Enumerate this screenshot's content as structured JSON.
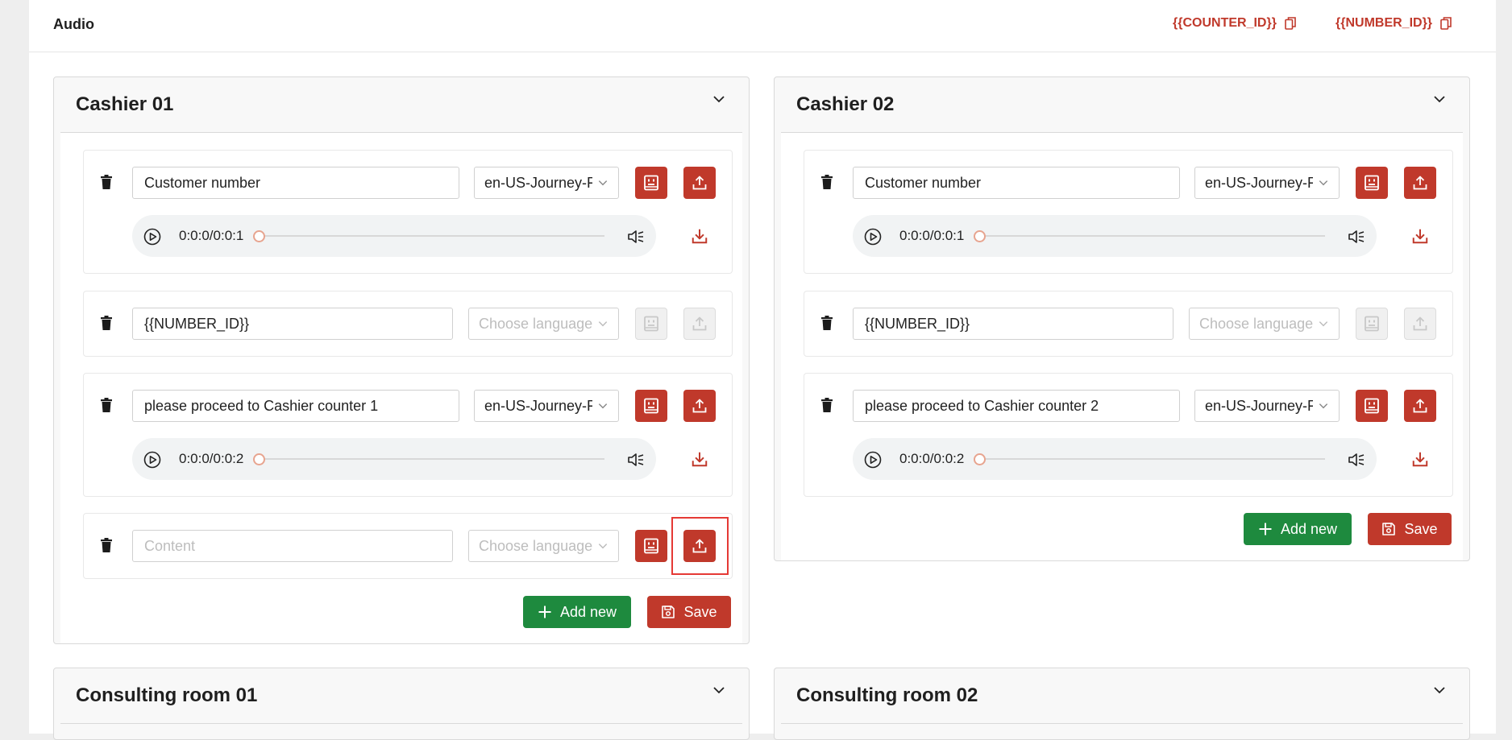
{
  "header": {
    "title": "Audio",
    "tags": [
      {
        "label": "{{COUNTER_ID}}",
        "icon": "copy-icon"
      },
      {
        "label": "{{NUMBER_ID}}",
        "icon": "copy-icon"
      }
    ]
  },
  "colors": {
    "accent": "#c0392b",
    "add_button": "#1e8a3e",
    "highlight": "#e53935"
  },
  "panels": [
    {
      "title": "Cashier 01",
      "items": [
        {
          "text": "Customer number",
          "language": "en-US-Journey-F",
          "time": "0:0:0/0:0:1"
        },
        {
          "text": "{{NUMBER_ID}}",
          "language_placeholder": "Choose language"
        },
        {
          "text": "please proceed to Cashier counter 1",
          "language": "en-US-Journey-F",
          "time": "0:0:0/0:0:2"
        },
        {
          "text_placeholder": "Content",
          "language_placeholder": "Choose language"
        }
      ],
      "add_label": "Add new",
      "save_label": "Save"
    },
    {
      "title": "Cashier 02",
      "items": [
        {
          "text": "Customer number",
          "language": "en-US-Journey-F",
          "time": "0:0:0/0:0:1"
        },
        {
          "text": "{{NUMBER_ID}}",
          "language_placeholder": "Choose language"
        },
        {
          "text": "please proceed to Cashier counter 2",
          "language": "en-US-Journey-F",
          "time": "0:0:0/0:0:2"
        }
      ],
      "add_label": "Add new",
      "save_label": "Save"
    },
    {
      "title": "Consulting room 01"
    },
    {
      "title": "Consulting room 02"
    }
  ]
}
